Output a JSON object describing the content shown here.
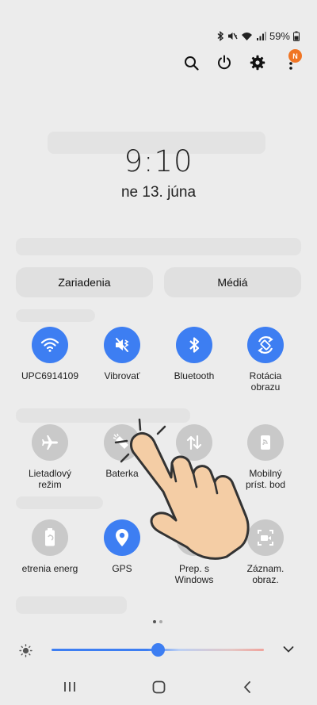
{
  "status_bar": {
    "battery": "59%"
  },
  "top_actions": {
    "notification_badge": "N"
  },
  "clock": {
    "time": "9:10",
    "date": "ne 13. júna"
  },
  "segments": {
    "devices": "Zariadenia",
    "media": "Médiá"
  },
  "tiles": [
    {
      "label": "UPC6914109",
      "state": "on",
      "icon": "wifi-icon"
    },
    {
      "label": "Vibrovať",
      "state": "on",
      "icon": "vibrate-icon"
    },
    {
      "label": "Bluetooth",
      "state": "on",
      "icon": "bluetooth-icon"
    },
    {
      "label": "Rotácia\nobrazu",
      "state": "on",
      "icon": "rotate-icon"
    },
    {
      "label": "Lietadlový\nrežim",
      "state": "off",
      "icon": "airplane-icon"
    },
    {
      "label": "Baterka",
      "state": "off",
      "icon": "flashlight-icon"
    },
    {
      "label": "",
      "state": "off",
      "icon": "mobile-data-icon"
    },
    {
      "label": "Mobilný\npríst. bod",
      "state": "off",
      "icon": "hotspot-icon"
    },
    {
      "label": "etrenia energ",
      "state": "off",
      "icon": "power-saving-icon"
    },
    {
      "label": "GPS",
      "state": "on",
      "icon": "location-icon"
    },
    {
      "label": "Prep. s\nWindows",
      "state": "off",
      "icon": "link-windows-icon"
    },
    {
      "label": "Záznam.\nobraz.",
      "state": "off",
      "icon": "screen-recorder-icon"
    }
  ],
  "brightness": {
    "level": 0.5
  },
  "colors": {
    "accent": "#3d7ef2",
    "tile_off": "#c9c9c9",
    "badge": "#f07524"
  }
}
